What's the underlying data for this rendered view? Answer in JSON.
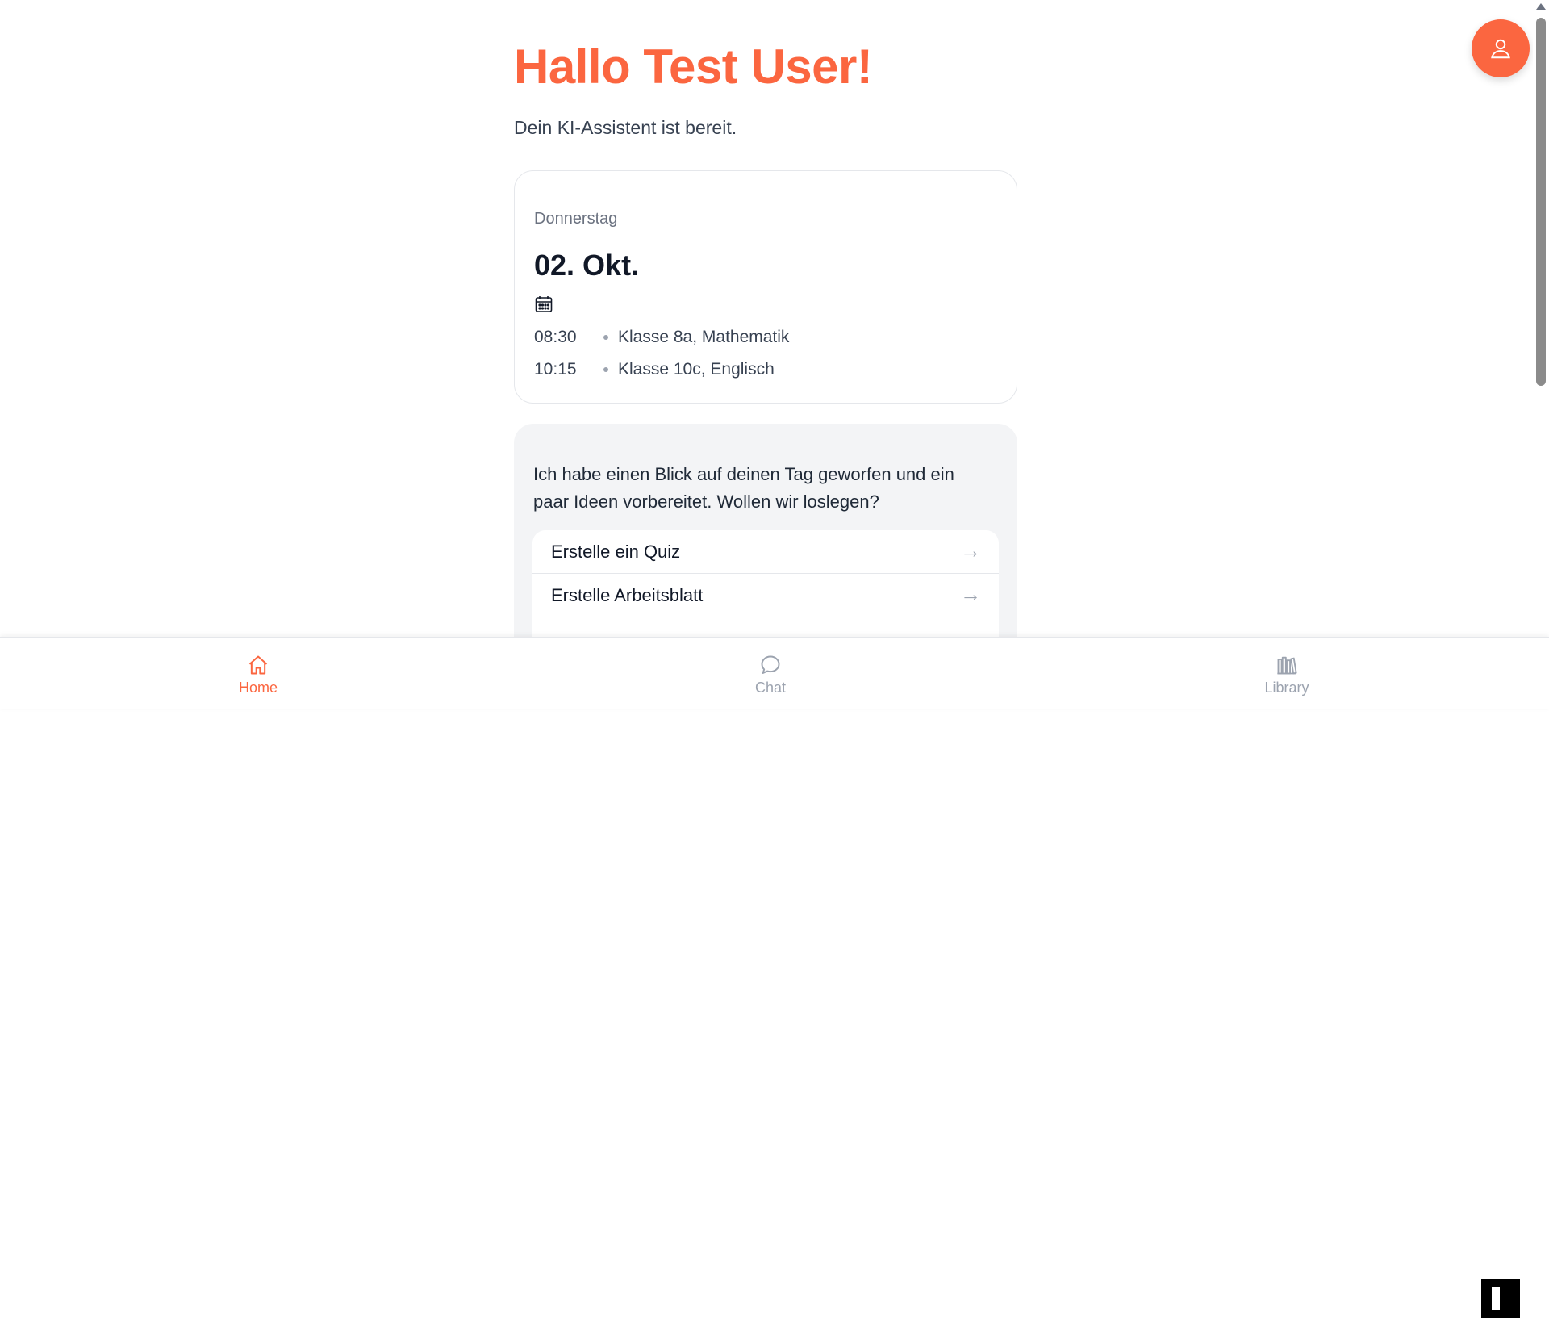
{
  "greeting": "Hallo Test User!",
  "subtitle": "Dein KI-Assistent ist bereit.",
  "schedule": {
    "weekday": "Donnerstag",
    "date": "02. Okt.",
    "events": [
      {
        "time": "08:30",
        "title": "Klasse 8a, Mathematik"
      },
      {
        "time": "10:15",
        "title": "Klasse 10c, Englisch"
      }
    ]
  },
  "ideas": {
    "text": "Ich habe einen Blick auf deinen Tag geworfen und ein paar Ideen vorbereitet. Wollen wir loslegen?",
    "actions": [
      {
        "label": "Erstelle ein Quiz",
        "arrow": "→"
      },
      {
        "label": "Erstelle Arbeitsblatt",
        "arrow": "→"
      },
      {
        "label": "",
        "arrow": ""
      }
    ]
  },
  "nav": {
    "home": "Home",
    "chat": "Chat",
    "library": "Library"
  },
  "colors": {
    "accent": "#fb6640",
    "inactive": "#9ca3af"
  },
  "icons": {
    "profile": "user-icon",
    "calendar": "calendar-icon",
    "home": "home-icon",
    "chat": "chat-bubble-icon",
    "library": "library-books-icon"
  }
}
